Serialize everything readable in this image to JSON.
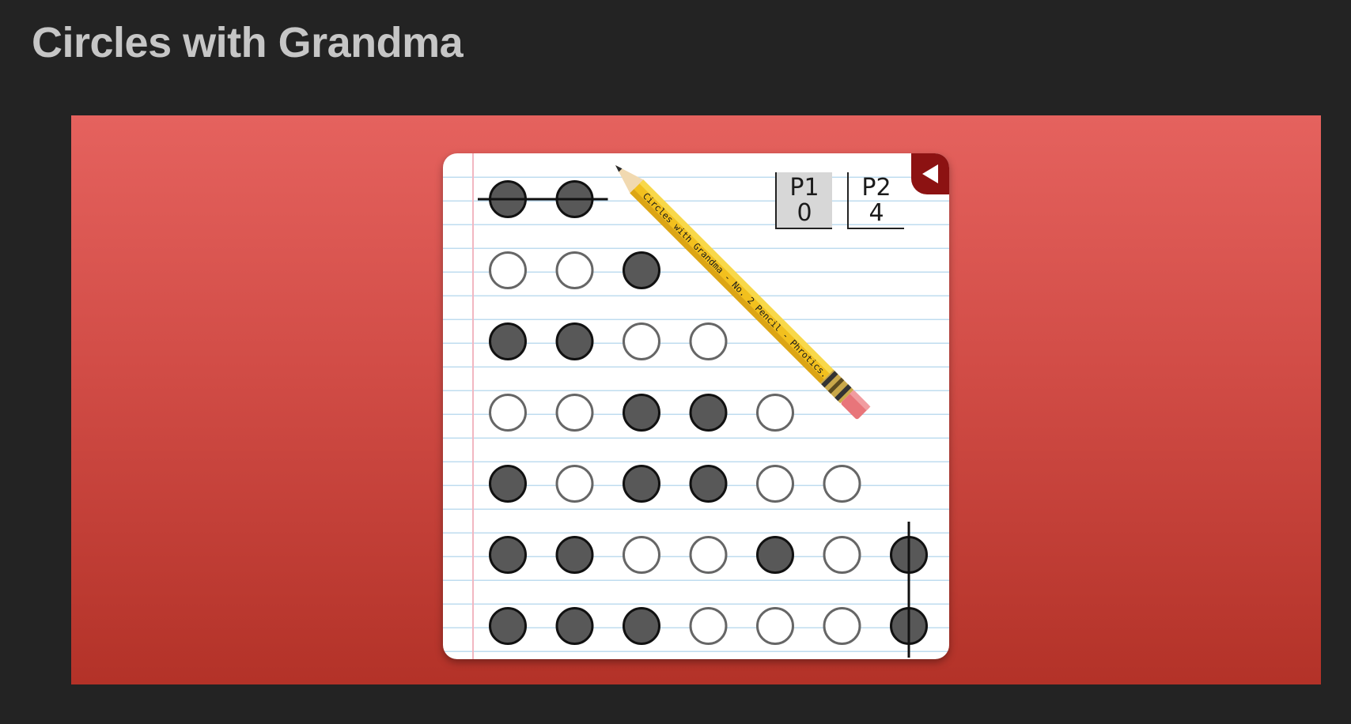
{
  "page": {
    "title": "Circles with Grandma"
  },
  "scoreboard": {
    "p1": {
      "label": "P1",
      "score": "0"
    },
    "p2": {
      "label": "P2",
      "score": "4"
    }
  },
  "pencil": {
    "imprint": "Circles with Grandma - No. 2 Pencil - Phrotics.com"
  },
  "colors": {
    "background": "#232323",
    "title": "#c6c6c6",
    "stage_top": "#e5625e",
    "stage_bottom": "#b33228",
    "filled_circle": "#585858",
    "empty_circle_stroke": "#666666",
    "back_button": "#8c1212",
    "pencil_body": "#f2c01e"
  },
  "board": {
    "rows": [
      {
        "circles": [
          "filled",
          "filled"
        ],
        "strike": "horizontal"
      },
      {
        "circles": [
          "empty",
          "empty",
          "filled"
        ]
      },
      {
        "circles": [
          "filled",
          "filled",
          "empty",
          "empty"
        ]
      },
      {
        "circles": [
          "empty",
          "empty",
          "filled",
          "filled",
          "empty"
        ]
      },
      {
        "circles": [
          "filled",
          "empty",
          "filled",
          "filled",
          "empty",
          "empty"
        ]
      },
      {
        "circles": [
          "filled",
          "filled",
          "empty",
          "empty",
          "filled",
          "empty",
          "filled"
        ]
      },
      {
        "circles": [
          "filled",
          "filled",
          "filled",
          "empty",
          "empty",
          "empty",
          "filled"
        ]
      }
    ],
    "vertical_strike_column": 7,
    "vertical_strike_rows": [
      6,
      7
    ]
  },
  "icons": {
    "back": "back-arrow-icon",
    "pencil": "pencil-icon"
  }
}
